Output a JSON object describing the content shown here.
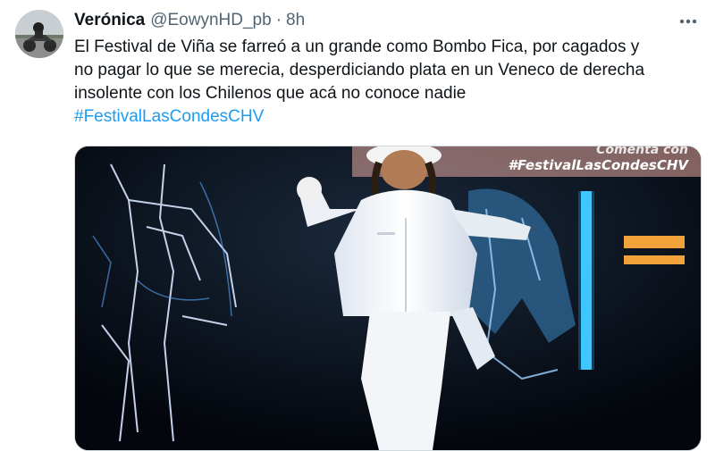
{
  "tweet": {
    "author_name": "Verónica",
    "author_handle": "@EowynHD_pb",
    "separator": "·",
    "timestamp": "8h",
    "text_lines": [
      "El Festival de Viña se farreó a un grande como Bombo Fica, por cagados y",
      "no pagar lo que se merecia, desperdiciando plata en un Veneco de derecha",
      "insolente con los Chilenos que acá  no conoce nadie"
    ],
    "hashtag": "#FestivalLasCondesCHV",
    "more_icon": "more-horizontal-icon",
    "avatar_icon": "motorcycle-avatar"
  },
  "media": {
    "overlay_top": "Comenta con",
    "overlay_hashtag": "#FestivalLasCondesCHV",
    "accent_blue": "#1d9bf0"
  }
}
